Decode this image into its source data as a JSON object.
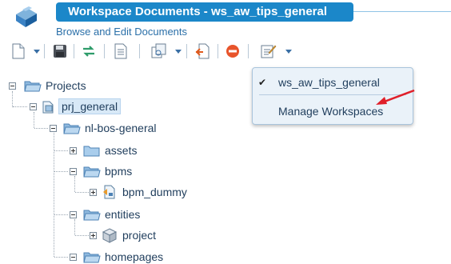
{
  "header": {
    "title": "Workspace Documents - ws_aw_tips_general",
    "subtitle": "Browse and Edit Documents"
  },
  "toolbar": {
    "buttons": [
      {
        "icon": "new-document-icon",
        "has_menu": true
      },
      {
        "icon": "save-icon"
      },
      {
        "icon": "sync-icon"
      },
      {
        "icon": "properties-icon"
      },
      {
        "icon": "copy-icon",
        "has_menu": true
      },
      {
        "icon": "import-icon"
      },
      {
        "icon": "delete-icon"
      },
      {
        "icon": "workspace-settings-icon",
        "has_menu": true
      }
    ]
  },
  "tree": {
    "root": "Projects",
    "project": "prj_general",
    "module": "nl-bos-general",
    "folders": [
      "assets",
      "bpms",
      "entities",
      "homepages"
    ],
    "bpms_child": "bpm_dummy",
    "entities_child": "project"
  },
  "workspace_menu": {
    "items": [
      {
        "label": "ws_aw_tips_general",
        "checked": true
      },
      {
        "label": "Manage Workspaces",
        "checked": false
      }
    ]
  },
  "colors": {
    "title_bar": "#1b87c9",
    "accent_arrow": "#e0202a",
    "menu_bg": "#eaf2f9"
  }
}
